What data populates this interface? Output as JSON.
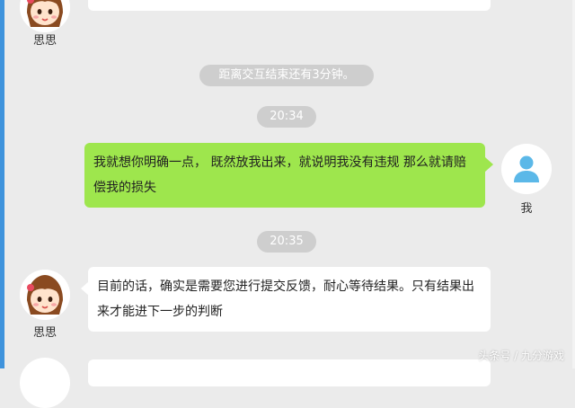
{
  "chat": {
    "contact_name": "思思",
    "self_name": "我",
    "system_notice": "距离交互结束还有3分钟。",
    "timestamps": [
      "20:34",
      "20:35"
    ],
    "messages": [
      {
        "sender": "我",
        "text": "我就想你明确一点， 既然放我出来，就说明我没有违规 那么就请赔偿我的损失"
      },
      {
        "sender": "思思",
        "text": "目前的话，确实是需要您进行提交反馈，耐心等待结果。只有结果出来才能进下一步的判断"
      }
    ]
  },
  "watermark": "头条号 / 九分游戏",
  "colors": {
    "background": "#ebebeb",
    "own_bubble": "#9ee64d",
    "other_bubble": "#ffffff",
    "pill": "#cecece",
    "side_bar": "#3f93dc",
    "self_avatar_icon": "#5bb8e8"
  },
  "icons": [
    "girl-avatar-icon",
    "user-silhouette-icon"
  ]
}
